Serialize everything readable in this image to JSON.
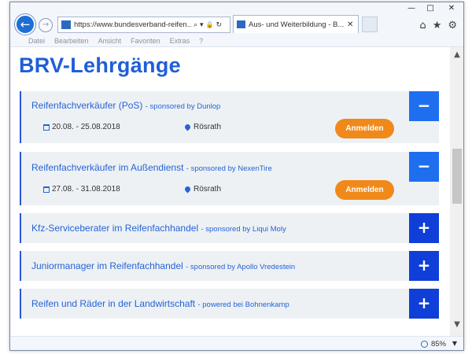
{
  "window": {
    "controls": {
      "minimize": "—",
      "maximize": "□",
      "close": "✕"
    }
  },
  "browser": {
    "back_glyph": "←",
    "forward_glyph": "→",
    "url": "https://www.bundesverband-reifen...",
    "addr_icons": {
      "search": "⌕",
      "dropdown": "▾",
      "lock": "🔒",
      "refresh": "↻"
    },
    "tab_title": "Aus- und Weiterbildung - B...",
    "tab_close": "✕",
    "right_icons": {
      "home": "⌂",
      "favorites": "★",
      "settings": "⚙"
    }
  },
  "menu": [
    "Datei",
    "Bearbeiten",
    "Ansicht",
    "Favoriten",
    "Extras",
    "?"
  ],
  "page": {
    "title": "BRV-Lehrgänge",
    "courses": [
      {
        "title": "Reifenfachverkäufer (PoS)",
        "sponsor": "- sponsored by Dunlop",
        "toggle": "−",
        "date": "20.08. - 25.08.2018",
        "location": "Rösrath",
        "register": "Anmelden"
      },
      {
        "title": "Reifenfachverkäufer im Außendienst",
        "sponsor": "- sponsored by NexenTire",
        "toggle": "−",
        "date": "27.08. - 31.08.2018",
        "location": "Rösrath",
        "register": "Anmelden"
      },
      {
        "title": "Kfz-Serviceberater im Reifenfachhandel",
        "sponsor": "- sponsored by Liqui Moly",
        "toggle": "+"
      },
      {
        "title": "Juniormanager im Reifenfachhandel",
        "sponsor": "- sponsored by Apollo Vredestein",
        "toggle": "+"
      },
      {
        "title": "Reifen und Räder in der Landwirtschaft",
        "sponsor": "- powered bei Bohnenkamp",
        "toggle": "+"
      }
    ]
  },
  "scrollbar": {
    "up": "▲",
    "down": "▼"
  },
  "status": {
    "zoom": "85%",
    "zoom_caret": "▼"
  },
  "colors": {
    "accent": "#1f5fd6",
    "button_orange": "#f0891a",
    "toggle_open": "#1e6ff0",
    "toggle_closed": "#0f3fd8"
  }
}
